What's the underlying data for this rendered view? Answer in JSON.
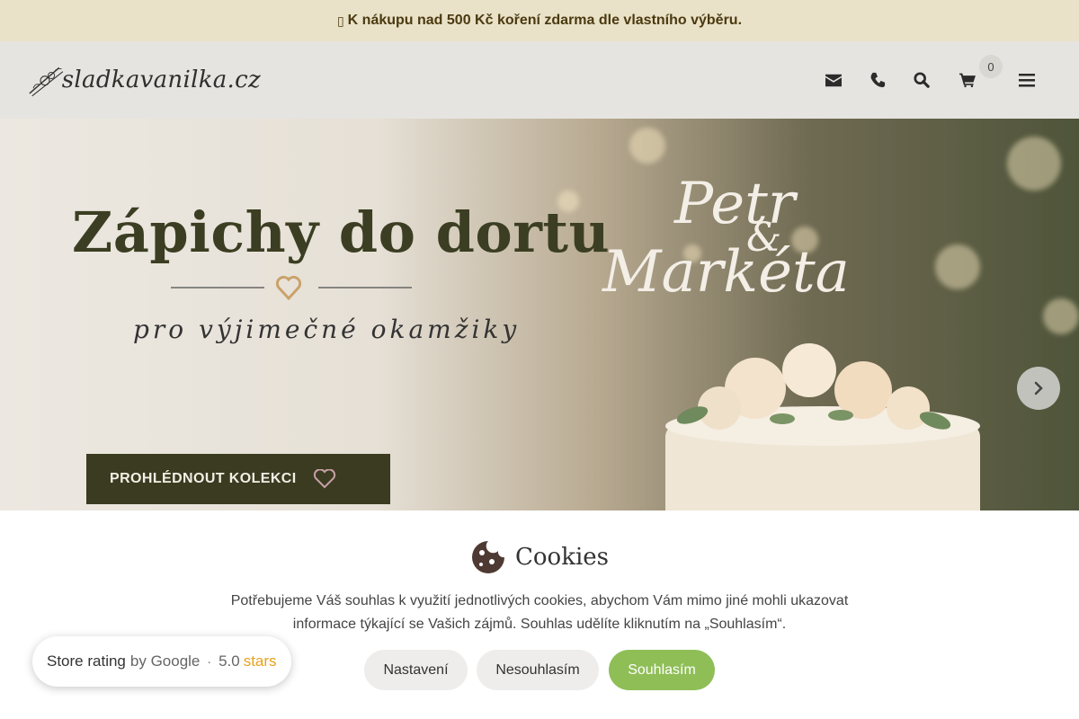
{
  "announcement": {
    "icon": "gift-icon",
    "text": "K nákupu nad 500 Kč koření zdarma dle vlastního výběru."
  },
  "header": {
    "logo_text": "sladkavanilka.cz",
    "icons": [
      "envelope-icon",
      "phone-icon",
      "search-icon",
      "cart-icon",
      "menu-icon"
    ],
    "cart_count": "0"
  },
  "hero": {
    "title": "Zápichy do dortu",
    "subtitle": "pro výjimečné okamžiky",
    "name_1": "Petr",
    "ampersand": "&",
    "name_2": "Markéta",
    "cta_label": "PROHLÉDNOUT KOLEKCI"
  },
  "cookies": {
    "title": "Cookies",
    "text": "Potřebujeme Váš souhlas k využití jednotlivých cookies, abychom Vám mimo jiné mohli ukazovat informace týkající se Vašich zájmů. Souhlas udělíte kliknutím na „Souhlasím“.",
    "settings_label": "Nastavení",
    "decline_label": "Nesouhlasím",
    "accept_label": "Souhlasím"
  },
  "rating": {
    "label": "Store rating",
    "by": "by Google",
    "separator": "·",
    "score": "5.0",
    "stars_text": "stars"
  },
  "colors": {
    "announcement_bg": "#e9e2c8",
    "header_bg": "#e6e4e0",
    "cta_bg": "#3a3b20",
    "accept_bg": "#8fbe57",
    "star_color": "#e8a21a"
  }
}
